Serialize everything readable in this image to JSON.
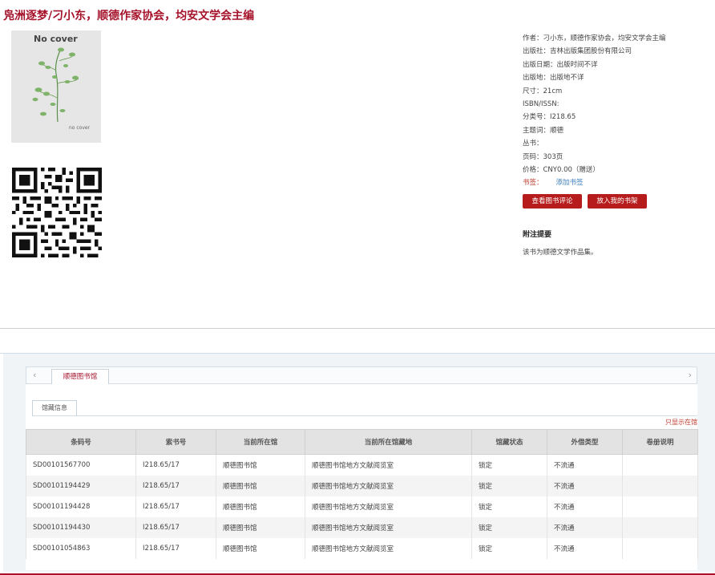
{
  "title": "凫洲逐梦/刁小东，顺德作家协会，均安文学会主编",
  "cover": {
    "top_text": "No cover",
    "bottom_text": "no cover"
  },
  "meta": {
    "author": "作者：刁小东，顺德作家协会，均安文学会主编",
    "publisher": "出版社：吉林出版集团股份有限公司",
    "pub_date": "出版日期：出版时间不详",
    "pub_place": "出版地：出版地不详",
    "size": "尺寸：21cm",
    "isbn": "ISBN/ISSN:",
    "classification": "分类号：I218.65",
    "subject": "主题词：顺德",
    "series": "丛书：",
    "pages": "页码：303页",
    "price": "价格：CNY0.00（赠送）",
    "tags_label": "书签：",
    "add_tag": "添加书签"
  },
  "buttons": {
    "review": "查看图书评论",
    "shelf": "放入我的书架"
  },
  "notes": {
    "heading": "附注提要",
    "body": "该书为顺德文学作品集。"
  },
  "holdings": {
    "library_tab": "顺德图书馆",
    "subtab": "馆藏信息",
    "only_in_library": "只显示在馆",
    "columns": [
      "条码号",
      "索书号",
      "当前所在馆",
      "当前所在馆藏地",
      "馆藏状态",
      "外借类型",
      "卷册说明"
    ],
    "rows": [
      [
        "SD00101567700",
        "I218.65/17",
        "顺德图书馆",
        "顺德图书馆地方文献阅览室",
        "锁定",
        "不流通",
        ""
      ],
      [
        "SD00101194429",
        "I218.65/17",
        "顺德图书馆",
        "顺德图书馆地方文献阅览室",
        "锁定",
        "不流通",
        ""
      ],
      [
        "SD00101194428",
        "I218.65/17",
        "顺德图书馆",
        "顺德图书馆地方文献阅览室",
        "锁定",
        "不流通",
        ""
      ],
      [
        "SD00101194430",
        "I218.65/17",
        "顺德图书馆",
        "顺德图书馆地方文献阅览室",
        "锁定",
        "不流通",
        ""
      ],
      [
        "SD00101054863",
        "I218.65/17",
        "顺德图书馆",
        "顺德图书馆地方文献阅览室",
        "锁定",
        "不流通",
        ""
      ]
    ]
  },
  "colors": {
    "accent": "#a5122a",
    "button": "#b71c1c",
    "link": "#3a7fc0"
  },
  "icons": [
    "chevron-left-icon",
    "chevron-right-icon",
    "qr-code-icon",
    "plant-illustration"
  ]
}
